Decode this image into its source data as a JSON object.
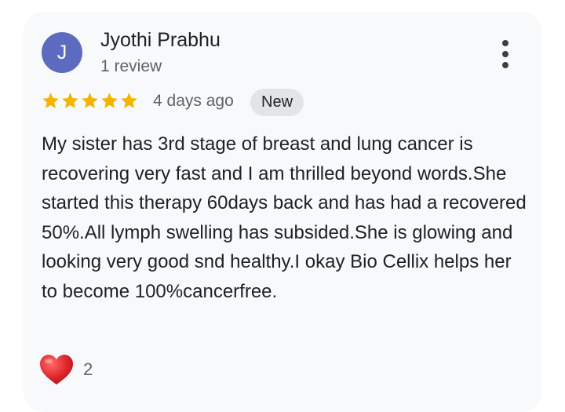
{
  "review": {
    "avatar_initial": "J",
    "author": "Jyothi Prabhu",
    "review_count": "1 review",
    "rating": 5,
    "rating_max": 5,
    "age": "4 days ago",
    "badge": "New",
    "text": "My sister has 3rd stage of breast and lung cancer is recovering very fast and I am thrilled beyond words.She started this therapy 60days back and has had a recovered 50%.All lymph swelling has subsided.She is glowing and looking very good snd healthy.I okay Bio Cellix helps her to become 100%cancerfree.",
    "reaction_count": "2"
  },
  "colors": {
    "avatar_bg": "#5c6bc0",
    "star": "#f4b400",
    "card_bg": "#f8f9fa",
    "heart": "#e0282e"
  },
  "icons": {
    "menu": "more-vertical-icon",
    "star": "star-icon",
    "reaction": "heart-icon"
  }
}
